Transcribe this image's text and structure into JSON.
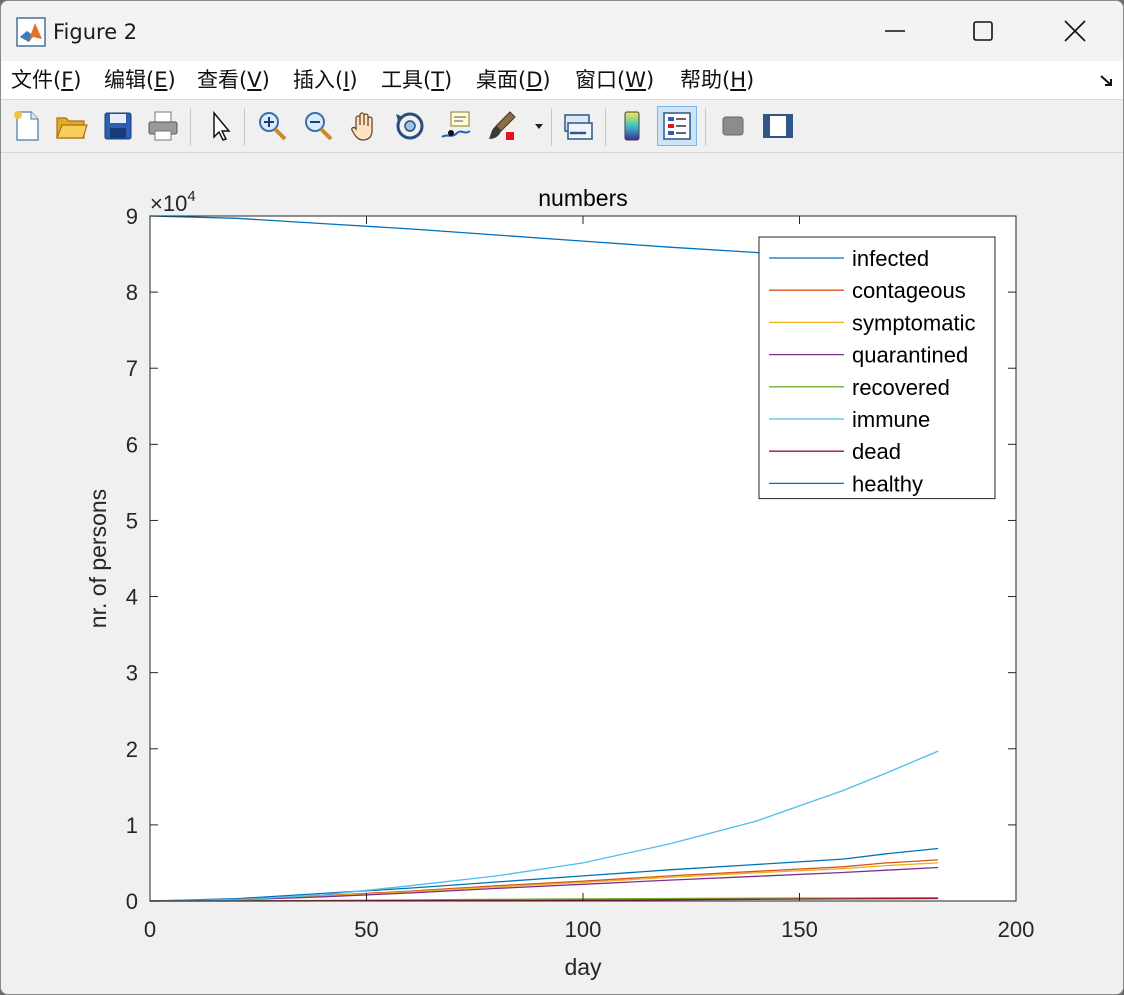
{
  "window": {
    "title": "Figure 2"
  },
  "menu": [
    {
      "label": "文件(",
      "key": "F",
      "end": ")"
    },
    {
      "label": "编辑(",
      "key": "E",
      "end": ")"
    },
    {
      "label": "查看(",
      "key": "V",
      "end": ")"
    },
    {
      "label": "插入(",
      "key": "I",
      "end": ")"
    },
    {
      "label": "工具(",
      "key": "T",
      "end": ")"
    },
    {
      "label": "桌面(",
      "key": "D",
      "end": ")"
    },
    {
      "label": "窗口(",
      "key": "W",
      "end": ")"
    },
    {
      "label": "帮助(",
      "key": "H",
      "end": ")"
    }
  ],
  "toolbar": {
    "icons": [
      "new-figure-icon",
      "open-file-icon",
      "save-icon",
      "print-icon",
      "pointer-icon",
      "zoom-in-icon",
      "zoom-out-icon",
      "pan-hand-icon",
      "rotate-3d-icon",
      "data-cursor-icon",
      "brush-icon",
      "link-plot-icon",
      "colorbar-icon",
      "legend-icon",
      "hide-plot-tools-icon",
      "show-plot-tools-icon"
    ]
  },
  "chart_data": {
    "type": "line",
    "title": "numbers",
    "xlabel": "day",
    "ylabel": "nr. of persons",
    "y_exponent_label": "×10",
    "y_exponent_power": "4",
    "xlim": [
      0,
      200
    ],
    "ylim": [
      0,
      90000
    ],
    "xticks": [
      "0",
      "50",
      "100",
      "150",
      "200"
    ],
    "yticks": [
      "0",
      "1",
      "2",
      "3",
      "4",
      "5",
      "6",
      "7",
      "8",
      "9"
    ],
    "legend_position": "top-right",
    "grid": false,
    "x": [
      0,
      20,
      40,
      60,
      80,
      100,
      120,
      140,
      160,
      170,
      182
    ],
    "series": [
      {
        "name": "infected",
        "color": "#0072BD",
        "values": [
          0,
          300,
          1000,
          1700,
          2500,
          3300,
          4100,
          4800,
          5500,
          6200,
          6900
        ]
      },
      {
        "name": "contageous",
        "color": "#D95319",
        "values": [
          0,
          200,
          700,
          1300,
          2000,
          2600,
          3300,
          3900,
          4500,
          5000,
          5400
        ]
      },
      {
        "name": "symptomatic",
        "color": "#EDB120",
        "values": [
          0,
          180,
          650,
          1200,
          1850,
          2450,
          3100,
          3700,
          4250,
          4650,
          5000
        ]
      },
      {
        "name": "quarantined",
        "color": "#7E2F8E",
        "values": [
          0,
          150,
          550,
          1050,
          1650,
          2200,
          2750,
          3250,
          3750,
          4050,
          4400
        ]
      },
      {
        "name": "recovered",
        "color": "#77AC30",
        "values": [
          0,
          20,
          80,
          150,
          220,
          280,
          330,
          370,
          400,
          420,
          440
        ]
      },
      {
        "name": "immune",
        "color": "#4DBEEE",
        "values": [
          0,
          150,
          800,
          2000,
          3300,
          5000,
          7500,
          10500,
          14500,
          16800,
          19700
        ]
      },
      {
        "name": "dead",
        "color": "#A2142F",
        "values": [
          0,
          5,
          20,
          50,
          80,
          120,
          170,
          220,
          270,
          300,
          330
        ]
      },
      {
        "name": "healthy",
        "color": "#0072BD",
        "values": [
          90000,
          89700,
          89000,
          88300,
          87500,
          86700,
          85900,
          85200,
          84500,
          83800,
          83100
        ]
      }
    ]
  }
}
